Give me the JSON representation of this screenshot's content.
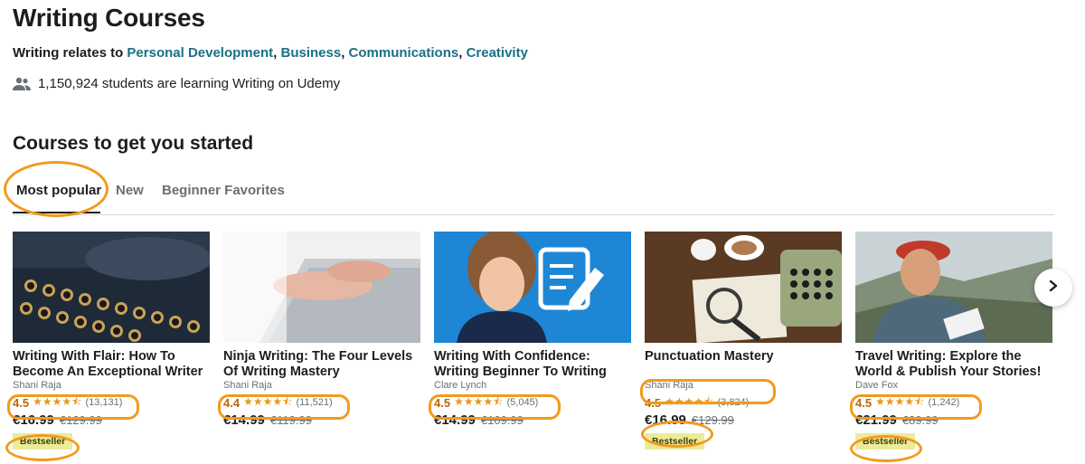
{
  "header": {
    "title": "Writing Courses",
    "relates_prefix": "Writing relates to",
    "topics": [
      "Personal Development",
      "Business",
      "Communications",
      "Creativity"
    ],
    "students_text": "1,150,924 students are learning Writing on Udemy"
  },
  "section": {
    "title": "Courses to get you started",
    "tabs": [
      "Most popular",
      "New",
      "Beginner Favorites"
    ],
    "active_tab": "Most popular"
  },
  "courses": [
    {
      "title": "Writing With Flair: How To Become An Exceptional Writer",
      "author": "Shani Raja",
      "rating": "4.5",
      "stars": "★★★★⯪",
      "count": "(13,131)",
      "price": "€16.99",
      "old_price": "€129.99",
      "badge": "Bestseller"
    },
    {
      "title": "Ninja Writing: The Four Levels Of Writing Mastery",
      "author": "Shani Raja",
      "rating": "4.4",
      "stars": "★★★★⯪",
      "count": "(11,521)",
      "price": "€14.99",
      "old_price": "€119.99",
      "badge": ""
    },
    {
      "title": "Writing With Confidence: Writing Beginner To Writing Pro",
      "author": "Clare Lynch",
      "rating": "4.5",
      "stars": "★★★★⯪",
      "count": "(5,045)",
      "price": "€14.99",
      "old_price": "€109.99",
      "badge": ""
    },
    {
      "title": "Punctuation Mastery",
      "author": "Shani Raja",
      "rating": "4.5",
      "stars": "★★★★⯪",
      "count": "(3,824)",
      "price": "€16.99",
      "old_price": "€129.99",
      "badge": "Bestseller"
    },
    {
      "title": "Travel Writing: Explore the World & Publish Your Stories!",
      "author": "Dave Fox",
      "rating": "4.5",
      "stars": "★★★★⯪",
      "count": "(1,242)",
      "price": "€21.99",
      "old_price": "€89.99",
      "badge": "Bestseller"
    }
  ],
  "colors": {
    "link": "#1a6f86",
    "rating": "#b4690e",
    "star": "#e59819",
    "badge_bg": "#eceb98",
    "highlight": "#f29a1d"
  },
  "icons": {
    "students": "people-icon",
    "next": "chevron-right-icon"
  }
}
